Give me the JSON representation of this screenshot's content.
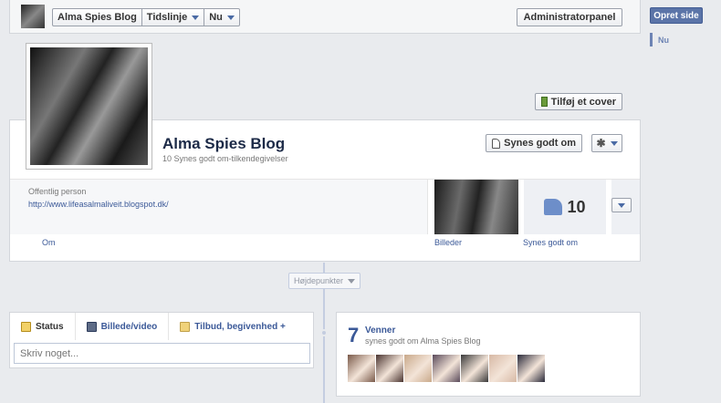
{
  "topbar": {
    "page_button": "Alma Spies Blog",
    "timeline_label": "Tidslinje",
    "now_label": "Nu",
    "admin_panel": "Administratorpanel"
  },
  "sidebar": {
    "create_page": "Opret side",
    "now_marker": "Nu"
  },
  "cover": {
    "add_cover": "Tilføj et cover"
  },
  "header": {
    "page_name": "Alma Spies Blog",
    "likes_subtitle": "10 Synes godt om-tilkendegivelser",
    "like_button": "Synes godt om",
    "gear_icon": "gear-icon"
  },
  "about": {
    "category": "Offentlig person",
    "website": "http://www.lifeasalmaliveit.blogspot.dk/"
  },
  "tiles": {
    "likes_count": "10",
    "tab_about": "Om",
    "tab_photos": "Billeder",
    "tab_likes": "Synes godt om"
  },
  "timeline": {
    "highlights": "Højdepunkter"
  },
  "composer": {
    "tab_status": "Status",
    "tab_photo": "Billede/video",
    "tab_offer": "Tilbud, begivenhed +",
    "placeholder": "Skriv noget..."
  },
  "friends": {
    "count": "7",
    "title": "Venner",
    "subtitle": "synes godt om Alma Spies Blog",
    "avatars": [
      "#7a5a4a",
      "#4a3430",
      "#c9a98a",
      "#5a4a5a",
      "#3a3a3a",
      "#d7b9a5",
      "#2a2a3a"
    ]
  },
  "colors": {
    "link": "#3b5998",
    "accent_button": "#5b74a8",
    "background": "#e9ebee"
  }
}
